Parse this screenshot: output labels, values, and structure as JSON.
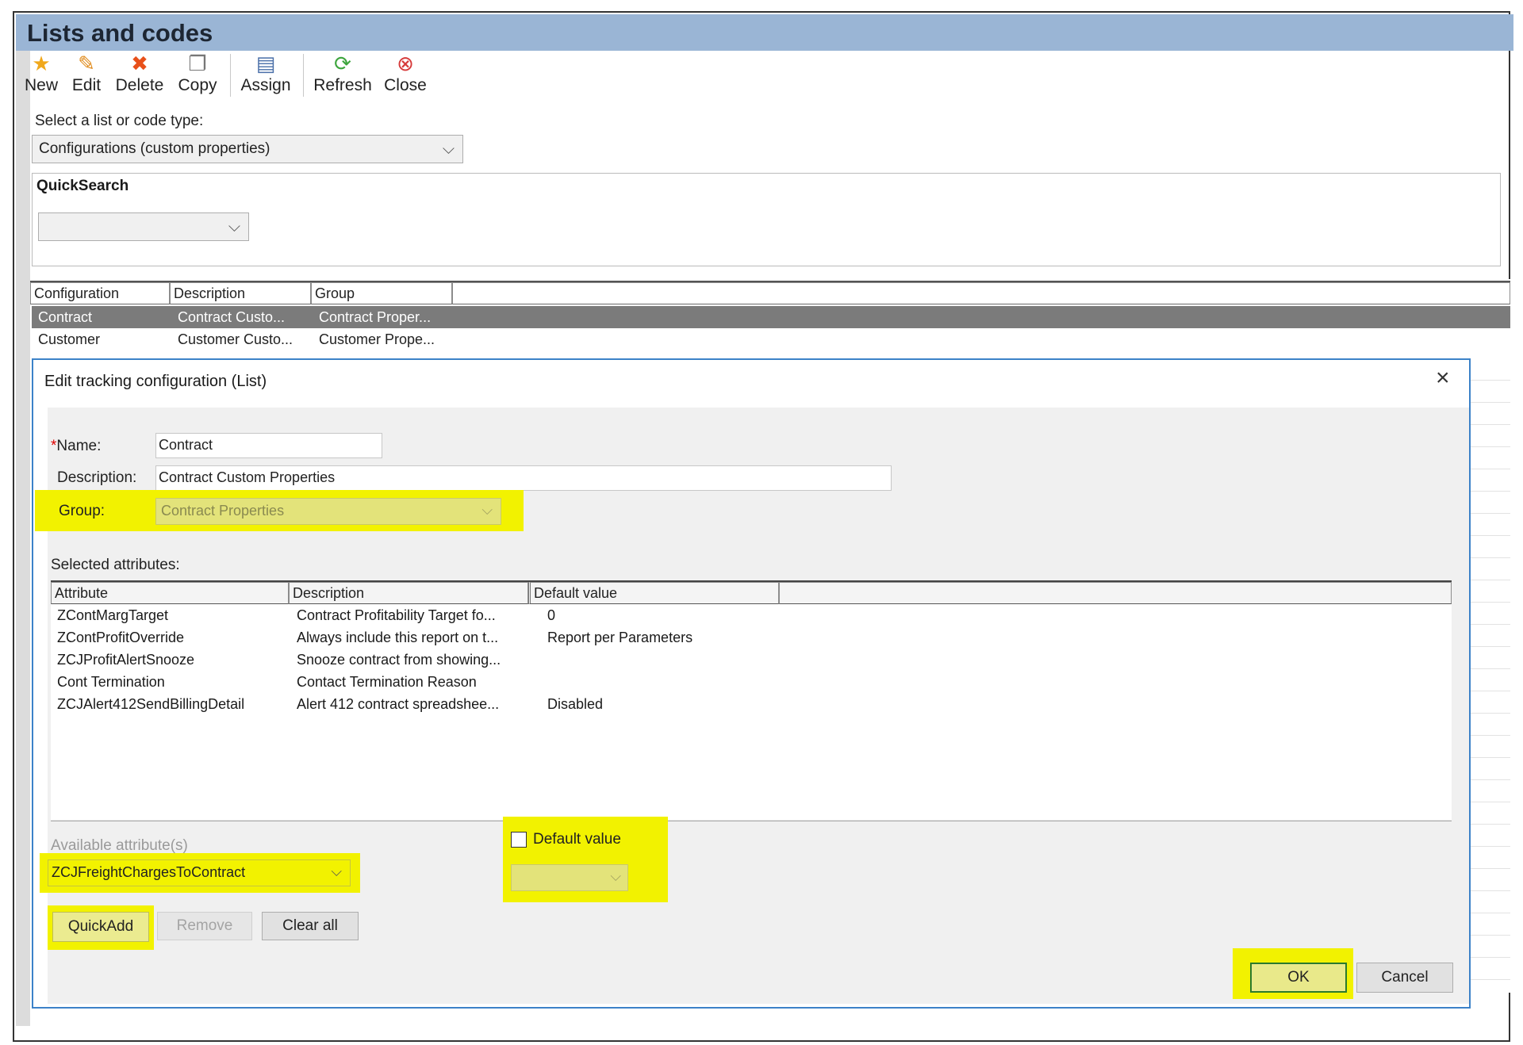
{
  "window": {
    "title": "Lists and codes"
  },
  "toolbar": {
    "new_label": "New",
    "edit_label": "Edit",
    "delete_label": "Delete",
    "copy_label": "Copy",
    "assign_label": "Assign",
    "refresh_label": "Refresh",
    "close_label": "Close"
  },
  "selector": {
    "label": "Select a list or code type:",
    "value": "Configurations (custom properties)"
  },
  "quicksearch": {
    "label": "QuickSearch",
    "value": ""
  },
  "grid": {
    "columns": [
      "Configuration",
      "Description",
      "Group"
    ],
    "rows": [
      {
        "configuration": "Contract",
        "description": "Contract Custo...",
        "group": "Contract Proper...",
        "selected": true
      },
      {
        "configuration": "Customer",
        "description": "Customer Custo...",
        "group": "Customer Prope...",
        "selected": false
      }
    ]
  },
  "dialog": {
    "title": "Edit tracking configuration (List)",
    "name_label": "Name:",
    "required_marker": "*",
    "name_value": "Contract",
    "description_label": "Description:",
    "description_value": "Contract Custom Properties",
    "group_label": "Group:",
    "group_value": "Contract Properties",
    "selected_attributes_label": "Selected attributes:",
    "attr_columns": [
      "Attribute",
      "Description",
      "Default value"
    ],
    "attributes": [
      {
        "attribute": "ZContMargTarget",
        "description": "Contract Profitability Target fo...",
        "default": "0"
      },
      {
        "attribute": "ZContProfitOverride",
        "description": "Always include this report on t...",
        "default": "Report per Parameters"
      },
      {
        "attribute": "ZCJProfitAlertSnooze",
        "description": "Snooze contract from showing...",
        "default": ""
      },
      {
        "attribute": "Cont Termination",
        "description": "Contact Termination Reason",
        "default": ""
      },
      {
        "attribute": "ZCJAlert412SendBillingDetail",
        "description": "Alert 412 contract spreadshee...",
        "default": "Disabled"
      }
    ],
    "available_label": "Available attribute(s)",
    "available_value": "ZCJFreightChargesToContract",
    "default_value_label": "Default value",
    "default_value_checked": false,
    "quickadd_label": "QuickAdd",
    "remove_label": "Remove",
    "clearall_label": "Clear all",
    "ok_label": "OK",
    "cancel_label": "Cancel"
  },
  "colors": {
    "titlebar": "#9ab5d5",
    "dialog_border": "#3c82c8",
    "highlight": "#f2f200",
    "selected_row": "#7b7b7b"
  }
}
